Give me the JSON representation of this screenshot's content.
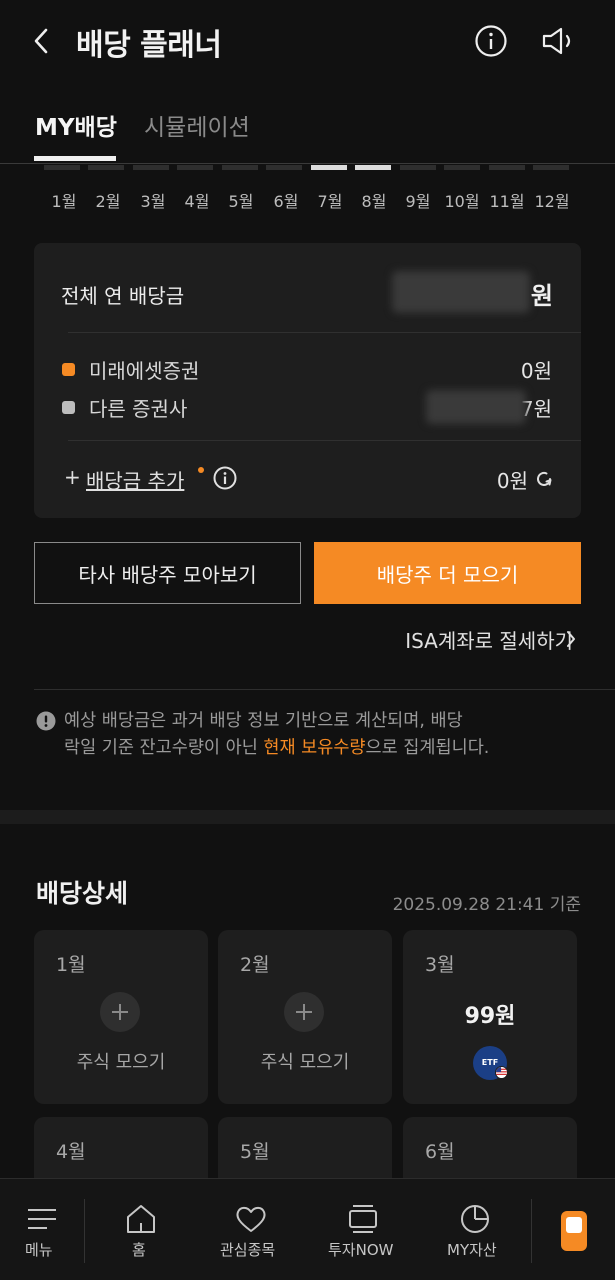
{
  "header": {
    "title": "배당 플래너"
  },
  "tabs": [
    {
      "label": "MY배당"
    },
    {
      "label": "시뮬레이션"
    }
  ],
  "months": [
    "1월",
    "2월",
    "3월",
    "4월",
    "5월",
    "6월",
    "7월",
    "8월",
    "9월",
    "10월",
    "11월",
    "12월"
  ],
  "summary": {
    "title": "전체 연 배당금",
    "total_suffix": "원",
    "brokers": [
      {
        "label": "미래에셋증권",
        "value": "0원",
        "color": "#f58a24"
      },
      {
        "label": "다른 증권사",
        "value": "7원",
        "color": "#bdbdbd"
      }
    ],
    "add": {
      "plus": "+",
      "label": "배당금 추가",
      "value": "0원"
    }
  },
  "buttons": {
    "other_broker": "타사 배당주 모아보기",
    "collect_more": "배당주 더 모으기"
  },
  "isa_link": "ISA계좌로 절세하기",
  "notice": {
    "line1": "예상 배당금은 과거 배당 정보 기반으로 계산되며, 배당",
    "line2_pre": "락일 기준 잔고수량이 아닌 ",
    "line2_highlight": "현재 보유수량",
    "line2_post": "으로 집계됩니다."
  },
  "detail": {
    "title": "배당상세",
    "timestamp": "2025.09.28 21:41 기준",
    "cards": [
      {
        "month": "1월",
        "action": "주식 모으기"
      },
      {
        "month": "2월",
        "action": "주식 모으기"
      },
      {
        "month": "3월",
        "amount": "99원",
        "badge": "ETF"
      },
      {
        "month": "4월"
      },
      {
        "month": "5월"
      },
      {
        "month": "6월"
      }
    ]
  },
  "bottom_nav": [
    {
      "label": "메뉴"
    },
    {
      "label": "홈"
    },
    {
      "label": "관심종목"
    },
    {
      "label": "투자NOW"
    },
    {
      "label": "MY자산"
    }
  ],
  "colors": {
    "accent": "#f58a24",
    "background": "#111111",
    "card": "#1e1e1e"
  }
}
